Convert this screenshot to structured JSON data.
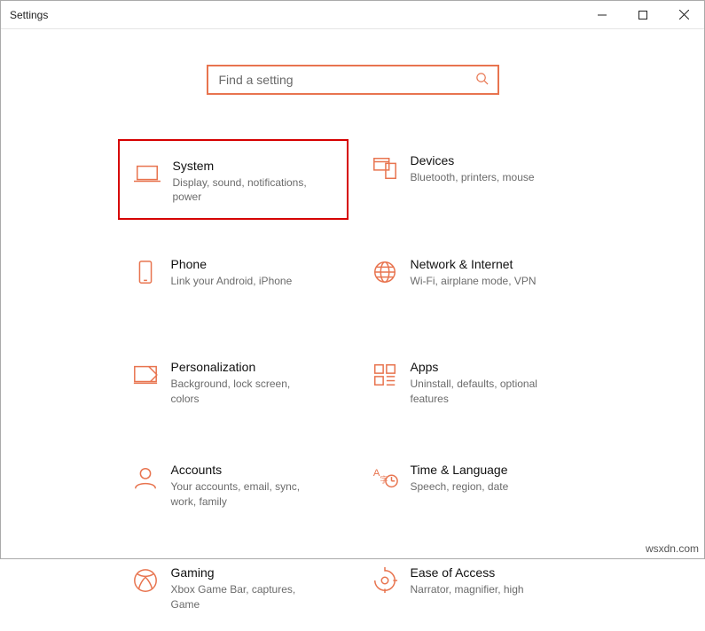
{
  "window": {
    "title": "Settings"
  },
  "search": {
    "placeholder": "Find a setting"
  },
  "tiles": [
    {
      "title": "System",
      "desc": "Display, sound, notifications, power"
    },
    {
      "title": "Devices",
      "desc": "Bluetooth, printers, mouse"
    },
    {
      "title": "Phone",
      "desc": "Link your Android, iPhone"
    },
    {
      "title": "Network & Internet",
      "desc": "Wi-Fi, airplane mode, VPN"
    },
    {
      "title": "Personalization",
      "desc": "Background, lock screen, colors"
    },
    {
      "title": "Apps",
      "desc": "Uninstall, defaults, optional features"
    },
    {
      "title": "Accounts",
      "desc": "Your accounts, email, sync, work, family"
    },
    {
      "title": "Time & Language",
      "desc": "Speech, region, date"
    },
    {
      "title": "Gaming",
      "desc": "Xbox Game Bar, captures, Game"
    },
    {
      "title": "Ease of Access",
      "desc": "Narrator, magnifier, high"
    }
  ],
  "watermark": "wsxdn.com"
}
